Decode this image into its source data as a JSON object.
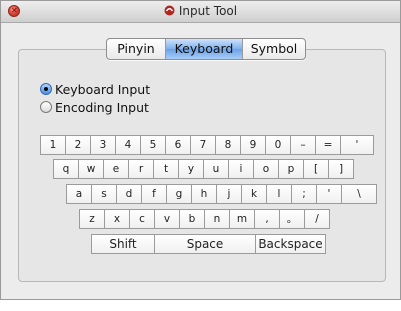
{
  "window": {
    "title": "Input Tool"
  },
  "tabs": [
    {
      "label": "Pinyin",
      "active": false
    },
    {
      "label": "Keyboard",
      "active": true
    },
    {
      "label": "Symbol",
      "active": false
    }
  ],
  "modes": [
    {
      "label": "Keyboard Input",
      "selected": true
    },
    {
      "label": "Encoding Input",
      "selected": false
    }
  ],
  "keyboard": {
    "rows": [
      [
        "1",
        "2",
        "3",
        "4",
        "5",
        "6",
        "7",
        "8",
        "9",
        "0",
        "–",
        "=",
        "'"
      ],
      [
        "q",
        "w",
        "e",
        "r",
        "t",
        "y",
        "u",
        "i",
        "o",
        "p",
        "[",
        "]"
      ],
      [
        "a",
        "s",
        "d",
        "f",
        "g",
        "h",
        "j",
        "k",
        "l",
        ";",
        "'",
        "\\"
      ],
      [
        "z",
        "x",
        "c",
        "v",
        "b",
        "n",
        "m",
        ",",
        "。",
        "/"
      ]
    ],
    "bottom": {
      "shift": "Shift",
      "space": "Space",
      "backspace": "Backspace"
    }
  },
  "colors": {
    "selected_tab": "#7fb0ec",
    "close_button": "#e0443a"
  }
}
